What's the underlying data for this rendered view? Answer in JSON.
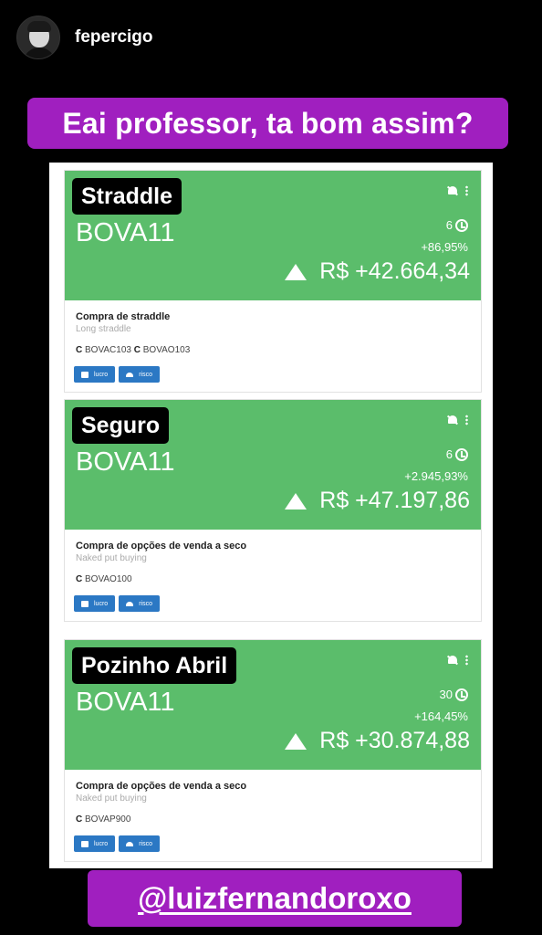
{
  "story": {
    "username": "fepercigo",
    "caption_top": "Eai professor, ta bom assim?",
    "caption_bottom": "@luizfernandoroxo"
  },
  "cards": [
    {
      "tag": "Straddle",
      "ticker": "BOVA11",
      "days": "6",
      "pct": "+86,95%",
      "profit": "R$ +42.664,34",
      "title": "Compra de straddle",
      "subtitle": "Long straddle",
      "legs": [
        {
          "type": "C",
          "symbol": "BOVAC103"
        },
        {
          "type": "C",
          "symbol": "BOVAO103"
        }
      ],
      "btn_lucro": "lucro",
      "btn_risco": "risco"
    },
    {
      "tag": "Seguro",
      "ticker": "BOVA11",
      "days": "6",
      "pct": "+2.945,93%",
      "profit": "R$ +47.197,86",
      "title": "Compra de opções de venda a seco",
      "subtitle": "Naked put buying",
      "legs": [
        {
          "type": "C",
          "symbol": "BOVAO100"
        }
      ],
      "btn_lucro": "lucro",
      "btn_risco": "risco"
    },
    {
      "tag": "Pozinho Abril",
      "ticker": "BOVA11",
      "days": "30",
      "pct": "+164,45%",
      "profit": "R$ +30.874,88",
      "title": "Compra de opções de venda a seco",
      "subtitle": "Naked put buying",
      "legs": [
        {
          "type": "C",
          "symbol": "BOVAP900"
        }
      ],
      "btn_lucro": "lucro",
      "btn_risco": "risco"
    }
  ],
  "colors": {
    "story_bg": "#000000",
    "caption_bg": "#a01fbf",
    "banner_green": "#5bbd6b",
    "button_blue": "#2b78c4"
  }
}
